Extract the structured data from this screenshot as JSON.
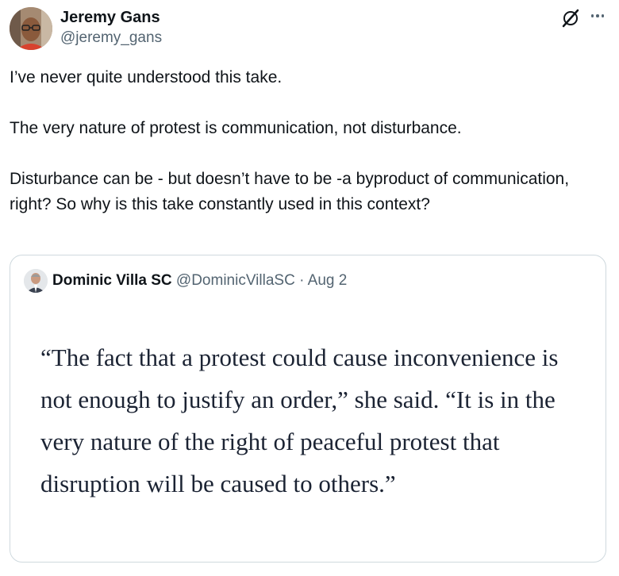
{
  "author": {
    "name": "Jeremy Gans",
    "handle": "@jeremy_gans",
    "avatar_icon": "profile-photo"
  },
  "icons": {
    "platform": "x-logo-icon",
    "more": "more-options-icon"
  },
  "tweet": {
    "paragraphs": [
      "I’ve never quite understood this take.",
      "The very nature of protest is communication, not disturbance.",
      "Disturbance can be - but doesn’t have to be -a byproduct of communication, right? So why is this take constantly used in this context?"
    ]
  },
  "quoted": {
    "name": "Dominic Villa SC",
    "handle": "@DominicVillaSC",
    "separator": " · ",
    "date": "Aug 2",
    "image_text": "“The fact that a protest could cause inconvenience is not enough to justify an order,” she said. “It is in the very nature of the right of peaceful protest that disruption will be caused to others.”"
  },
  "colors": {
    "text": "#0f1419",
    "secondary": "#536471",
    "border": "#cfd9de",
    "quote_text": "#1b2333"
  }
}
